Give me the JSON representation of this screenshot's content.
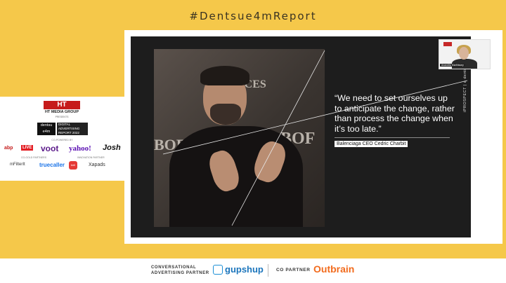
{
  "header": {
    "hashtag": "#Dentsue4mReport"
  },
  "slide": {
    "quote": "“We need to set ourselves up to anticipate the change, rather than process the change when it’s too late.”",
    "attribution": "Balenciaga CEO Cedric Charbit",
    "side_brand": "iPROSPECT | a dentsu company",
    "photo_texts": [
      "OICES",
      "BOF",
      "BOF"
    ]
  },
  "webcam": {
    "name_label": "Anandita Marthissey"
  },
  "sponsor_panel": {
    "ht_logo": "HT",
    "ht_name": "HT MEDIA GROUP",
    "presents": "PRESENTS",
    "dentsu": "dentsu e4m",
    "report": "DIGITAL ADVERTISING REPORT 2022",
    "co_powered": "CO-POWERED BY",
    "abp": "abp",
    "abp_live": "LIVE",
    "voot": "voot",
    "yahoo": "yahoo!",
    "josh": "Josh",
    "gold_partners": "CO-GOLD PARTNERS",
    "innovation_partners": "INNOVATION PARTNER",
    "filter": "mFilterIt",
    "truecaller": "truecaller",
    "trell": "trell",
    "xapads": "Xapads"
  },
  "footer": {
    "conv_line1": "CONVERSATIONAL",
    "conv_line2": "ADVERTISING PARTNER",
    "gupshup": "gupshup",
    "co_partner": "CO PARTNER",
    "outbrain": "Outbrain"
  },
  "colors": {
    "background": "#f5c84a",
    "slide": "#1d1d1d",
    "accent_red": "#c61b1b"
  }
}
